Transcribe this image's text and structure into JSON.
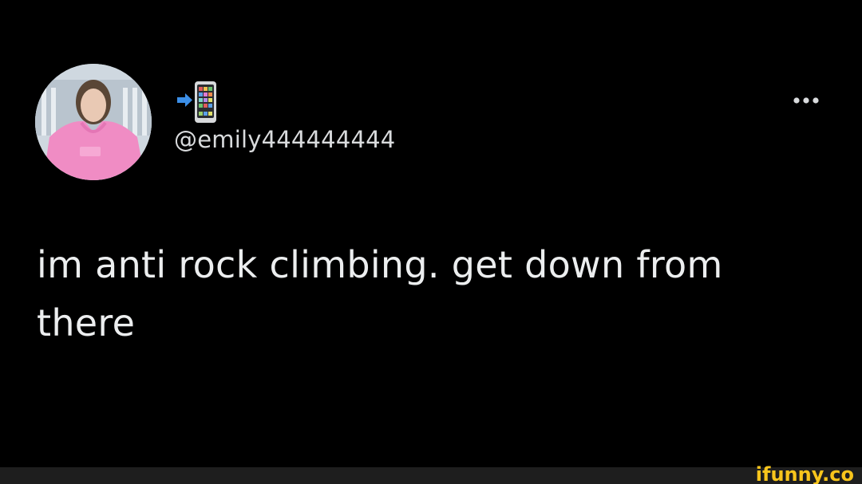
{
  "tweet": {
    "display_name_icon": "mobile-phone-with-arrow-emoji",
    "handle": "@emily444444444",
    "text": "im anti rock climbing. get down from there",
    "more_icon": "more-horizontal-icon"
  },
  "watermark": {
    "text": "ifunny.co",
    "color": "#f8c51c"
  },
  "colors": {
    "background": "#000000",
    "text": "#eceeef",
    "handle": "#d9dbdd"
  }
}
